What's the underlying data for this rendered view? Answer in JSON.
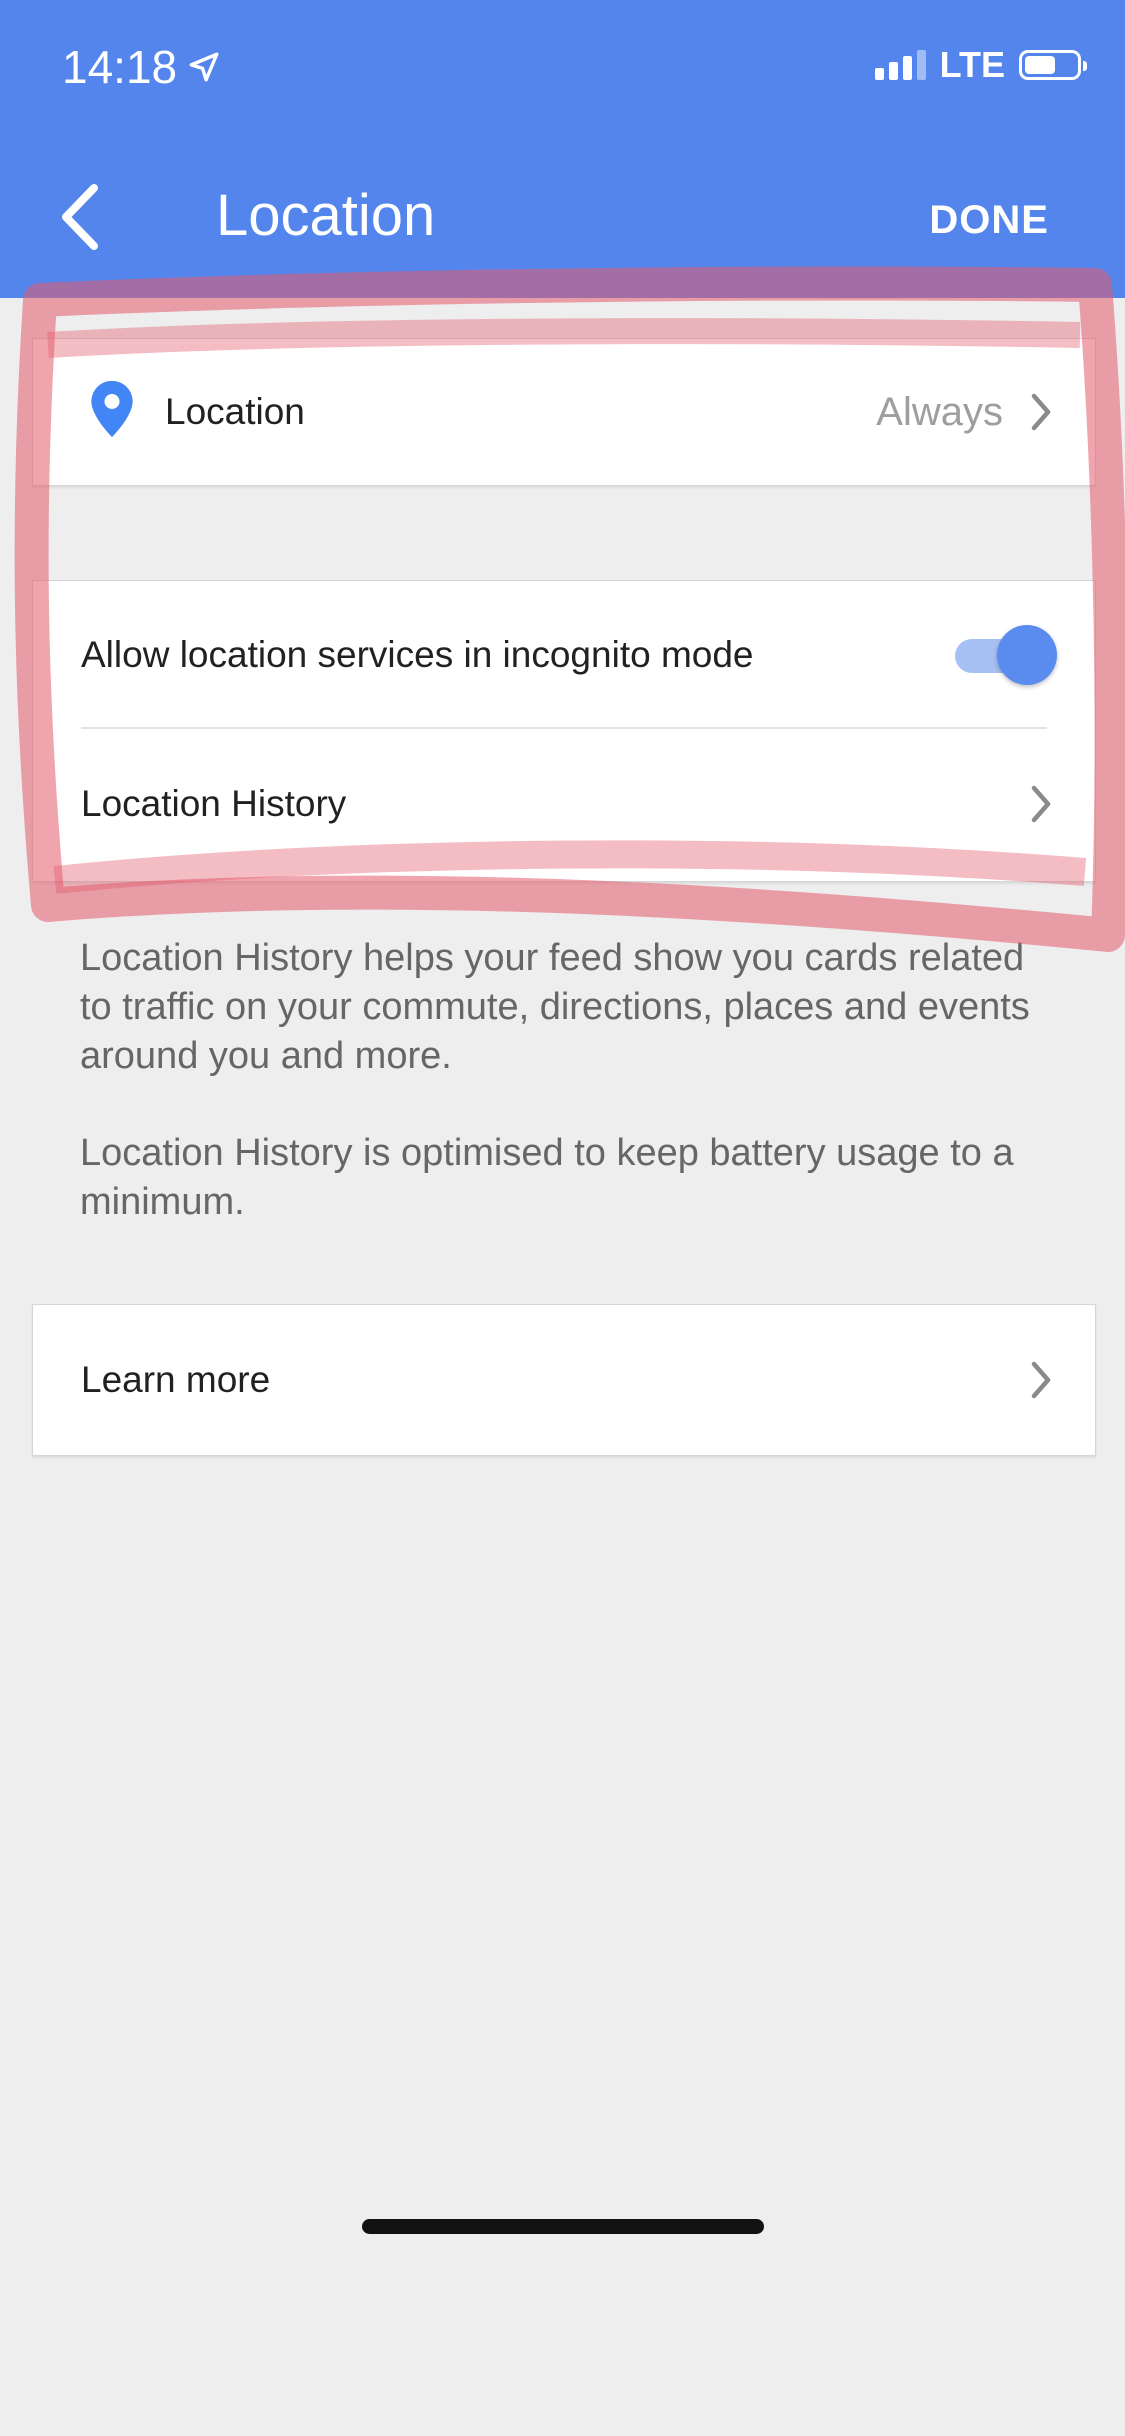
{
  "status_bar": {
    "time": "14:18",
    "network": "LTE"
  },
  "header": {
    "title": "Location",
    "done_label": "DONE"
  },
  "location_row": {
    "label": "Location",
    "value": "Always"
  },
  "incognito_row": {
    "label": "Allow location services in incognito mode",
    "enabled": true
  },
  "history_row": {
    "label": "Location History"
  },
  "description": {
    "paragraph1": "Location History helps your feed show you cards related to traffic on your commute, directions, places and events around you and more.",
    "paragraph2": "Location History is optimised to keep battery usage to a minimum."
  },
  "learn_more": {
    "label": "Learn more"
  },
  "colors": {
    "header": "#5385ec",
    "accent": "#4285f4",
    "annotation": "#e45b6b",
    "background": "#eeeeee"
  }
}
